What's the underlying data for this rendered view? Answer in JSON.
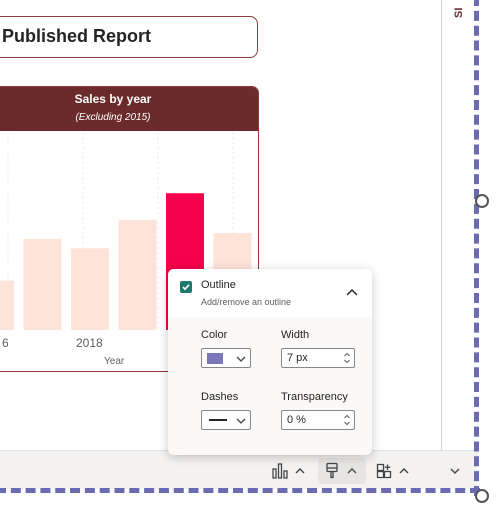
{
  "report": {
    "title": "Published Report",
    "side_tab_label": "SI"
  },
  "chart": {
    "title": "Sales by year",
    "subtitle": "(Excluding 2015)",
    "x_ticks": [
      "6",
      "2018"
    ],
    "x_axis_label": "Year"
  },
  "chart_data": {
    "type": "bar",
    "title": "Sales by year",
    "subtitle": "(Excluding 2015)",
    "xlabel": "Year",
    "ylabel": "",
    "visible_tick_labels": [
      "6",
      "2018"
    ],
    "values": [
      0.26,
      0.48,
      0.43,
      0.58,
      0.72,
      0.51
    ],
    "highlighted_index": 4,
    "colors": {
      "bar": "#fde3d8",
      "highlight": "#f5004a"
    },
    "grid": true,
    "legend": "none"
  },
  "outline_panel": {
    "checkbox_label": "Outline",
    "description": "Add/remove an outline",
    "checked": true,
    "color_label": "Color",
    "color_value": "#7b78b8",
    "width_label": "Width",
    "width_value": "7 px",
    "dashes_label": "Dashes",
    "transparency_label": "Transparency",
    "transparency_value": "0 %"
  },
  "toolbar": {
    "icons": [
      "bar-chart-icon",
      "paint-brush-icon",
      "analytics-icon",
      "chevron-down-icon"
    ]
  },
  "colors": {
    "accent": "#6b2b2b",
    "selection_dash": "#6b6bb3",
    "checkbox": "#1e7a6c"
  }
}
